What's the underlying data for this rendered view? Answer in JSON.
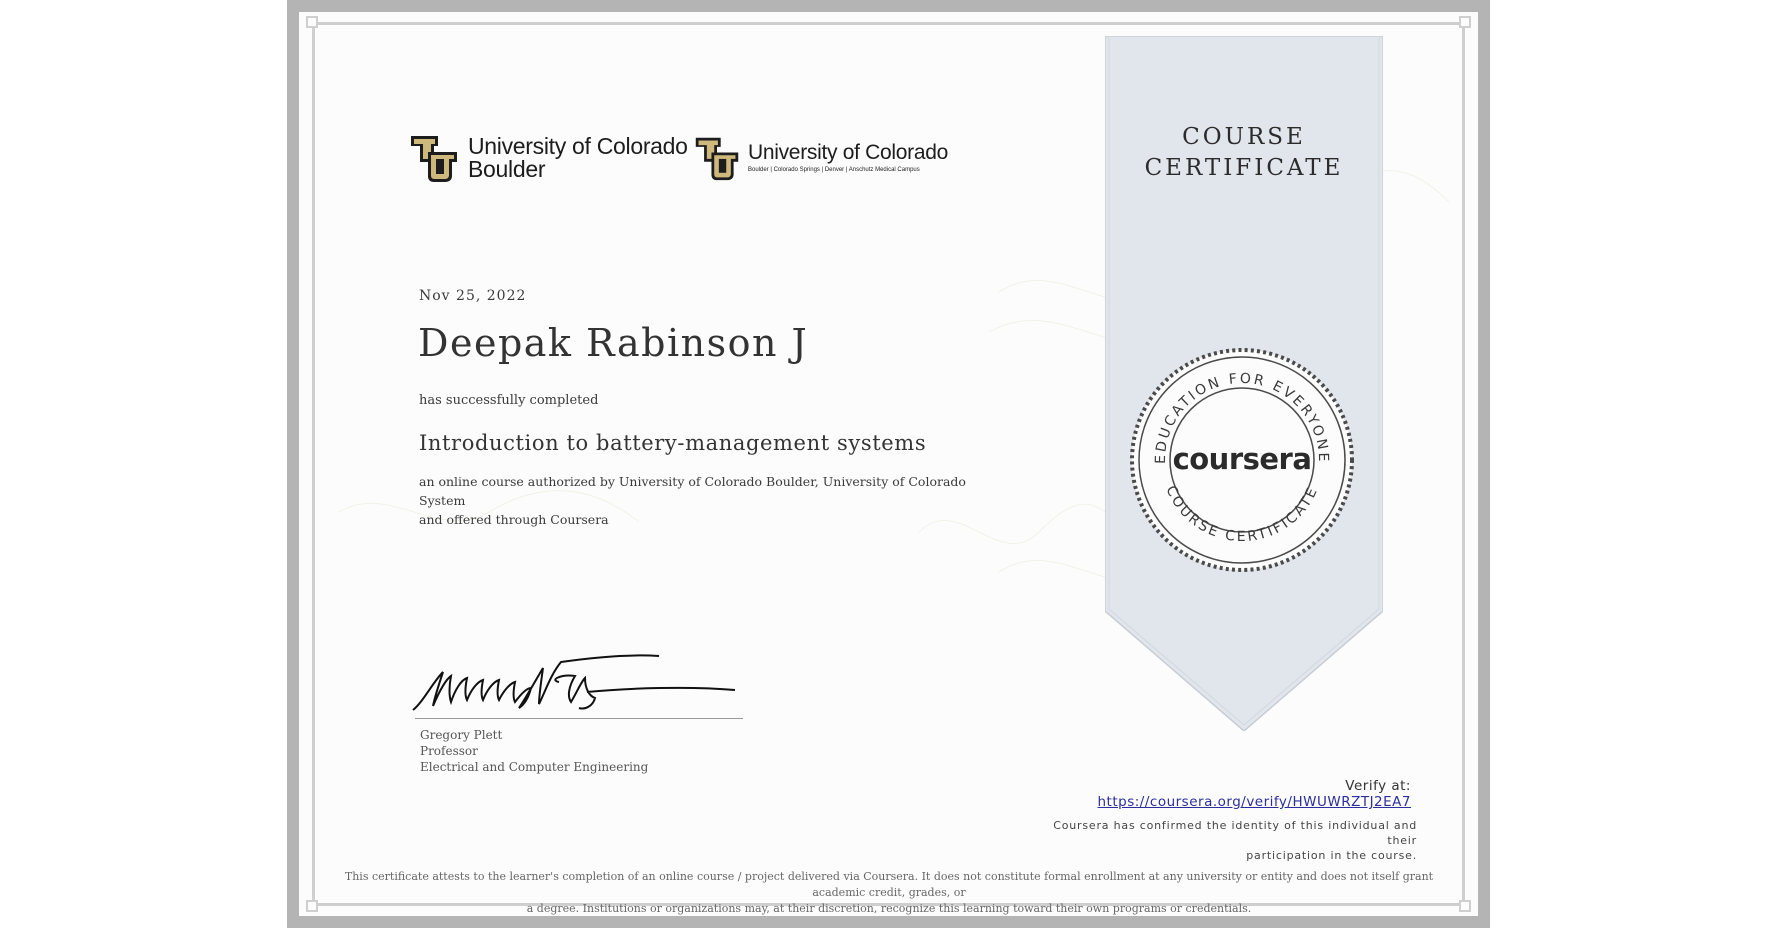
{
  "logos": {
    "boulder": {
      "line1": "University of Colorado",
      "line2": "Boulder"
    },
    "system": {
      "line1": "University of Colorado",
      "campuses": "Boulder | Colorado Springs | Denver | Anschutz Medical Campus"
    }
  },
  "certificate": {
    "ribbon_title_1": "COURSE",
    "ribbon_title_2": "CERTIFICATE",
    "date": "Nov 25, 2022",
    "recipient": "Deepak Rabinson J",
    "completed_text": "has successfully completed",
    "course_title": "Introduction to battery-management systems",
    "description_1": "an online course authorized by University of Colorado Boulder, University of Colorado System",
    "description_2": "and offered through Coursera"
  },
  "signer": {
    "name": "Gregory Plett",
    "title": "Professor",
    "department": "Electrical and Computer Engineering"
  },
  "seal": {
    "brand": "coursera",
    "top_text": "EDUCATION FOR EVERYONE",
    "bottom_text": "COURSE CERTIFICATE"
  },
  "verify": {
    "label": "Verify at:",
    "url": "https://coursera.org/verify/HWUWRZTJ2EA7",
    "note_1": "Coursera has confirmed the identity of this individual and their",
    "note_2": "participation in the course."
  },
  "disclaimer": {
    "line1": "This certificate attests to the learner's completion of an online course / project delivered via Coursera. It does not constitute formal enrollment at any university or entity and does not itself grant academic credit, grades, or",
    "line2": "a degree. Institutions or organizations may, at their discretion, recognize this learning toward their own programs or credentials."
  },
  "colors": {
    "frame": "#b4b4b4",
    "ribbon": "#e1e5ec",
    "cu_gold": "#cfb87c",
    "link": "#2a2f9c"
  }
}
